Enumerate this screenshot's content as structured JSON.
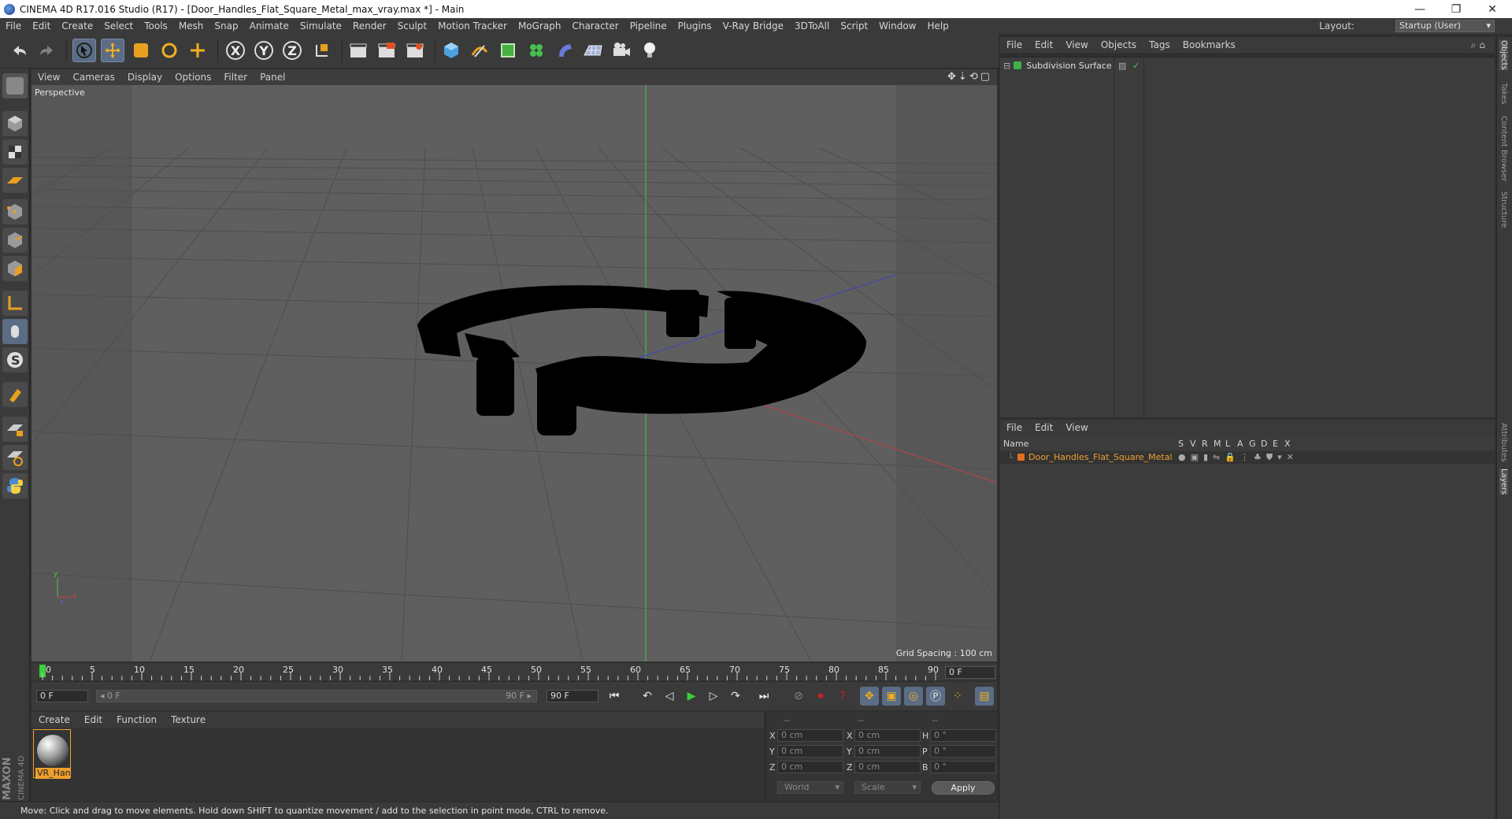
{
  "window": {
    "title": "CINEMA 4D R17.016 Studio (R17) - [Door_Handles_Flat_Square_Metal_max_vray.max *] - Main",
    "minimize": "—",
    "restore": "❐",
    "close": "✕"
  },
  "menu": [
    "File",
    "Edit",
    "Create",
    "Select",
    "Tools",
    "Mesh",
    "Snap",
    "Animate",
    "Simulate",
    "Render",
    "Sculpt",
    "Motion Tracker",
    "MoGraph",
    "Character",
    "Pipeline",
    "Plugins",
    "V-Ray Bridge",
    "3DToAll",
    "Script",
    "Window",
    "Help"
  ],
  "layout": {
    "label": "Layout:",
    "value": "Startup (User)"
  },
  "toolbar": {
    "x_label": "X",
    "y_label": "Y",
    "z_label": "Z"
  },
  "viewport": {
    "menu": [
      "View",
      "Cameras",
      "Display",
      "Options",
      "Filter",
      "Panel"
    ],
    "camera_label": "Perspective",
    "grid_spacing": "Grid Spacing : 100 cm",
    "axis_y": "y",
    "axis_x": "x",
    "axis_z": "z"
  },
  "timeline": {
    "ticks": [
      "0",
      "5",
      "10",
      "15",
      "20",
      "25",
      "30",
      "35",
      "40",
      "45",
      "50",
      "55",
      "60",
      "65",
      "70",
      "75",
      "80",
      "85",
      "90"
    ],
    "current_frame": "0 F"
  },
  "transport": {
    "start_field": "0 F",
    "range_start": "◂ 0 F",
    "range_end": "90 F ▸",
    "end_field": "90 F"
  },
  "materials": {
    "menu": [
      "Create",
      "Edit",
      "Function",
      "Texture"
    ],
    "items": [
      {
        "label": "VR_Han"
      }
    ]
  },
  "coords": {
    "header": [
      "--",
      "--",
      "--"
    ],
    "rows": [
      {
        "a": "X",
        "av": "0 cm",
        "b": "X",
        "bv": "0 cm",
        "c": "H",
        "cv": "0 °"
      },
      {
        "a": "Y",
        "av": "0 cm",
        "b": "Y",
        "bv": "0 cm",
        "c": "P",
        "cv": "0 °"
      },
      {
        "a": "Z",
        "av": "0 cm",
        "b": "Z",
        "bv": "0 cm",
        "c": "B",
        "cv": "0 °"
      }
    ],
    "space": "World",
    "mode": "Scale",
    "apply": "Apply"
  },
  "status": "Move: Click and drag to move elements. Hold down SHIFT to quantize movement / add to the selection in point mode, CTRL to remove.",
  "maxon": {
    "line1": "MAXON",
    "line2": "CINEMA 4D"
  },
  "objects_panel": {
    "menu": [
      "File",
      "Edit",
      "View",
      "Objects",
      "Tags",
      "Bookmarks"
    ],
    "items": [
      {
        "name": "Subdivision Surface"
      }
    ]
  },
  "layers_panel": {
    "menu": [
      "File",
      "Edit",
      "View"
    ],
    "columns": [
      "Name",
      "S",
      "V",
      "R",
      "M",
      "L",
      "A",
      "G",
      "D",
      "E",
      "X"
    ],
    "items": [
      {
        "name": "Door_Handles_Flat_Square_Metal",
        "color": "#e07020"
      }
    ]
  },
  "side_tabs": [
    "Objects",
    "Takes",
    "Content Browser",
    "Structure",
    "Attributes",
    "Layers"
  ],
  "colors": {
    "accent": "#f0a030",
    "selection": "#5b6c86",
    "play": "#3ccf3c",
    "record": "#d02020"
  }
}
